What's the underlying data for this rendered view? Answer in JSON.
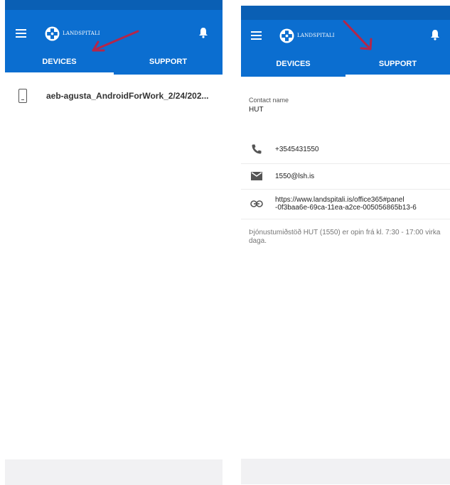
{
  "colors": {
    "header": "#0b6ed0",
    "status": "#0a5fb4",
    "annotation_arrow": "#b3264a"
  },
  "left": {
    "logo_text": "LANDSPITALI",
    "tabs": [
      {
        "label": "DEVICES",
        "active": true
      },
      {
        "label": "SUPPORT",
        "active": false
      }
    ],
    "device": {
      "icon": "phone-icon",
      "name": "aeb-agusta_AndroidForWork_2/24/202..."
    }
  },
  "right": {
    "logo_text": "LANDSPITALI",
    "tabs": [
      {
        "label": "DEVICES",
        "active": false
      },
      {
        "label": "SUPPORT",
        "active": true
      }
    ],
    "contact_label": "Contact name",
    "contact_value": "HUT",
    "phone": "+3545431550",
    "email": "1550@lsh.is",
    "url_line1": "https://www.landspitali.is/office365#panel",
    "url_line2": "-0f3baa6e-69ca-11ea-a2ce-005056865b13-6",
    "note": "Þjónustumiðstöð HUT (1550) er opin frá kl. 7:30 - 17:00 virka daga."
  }
}
